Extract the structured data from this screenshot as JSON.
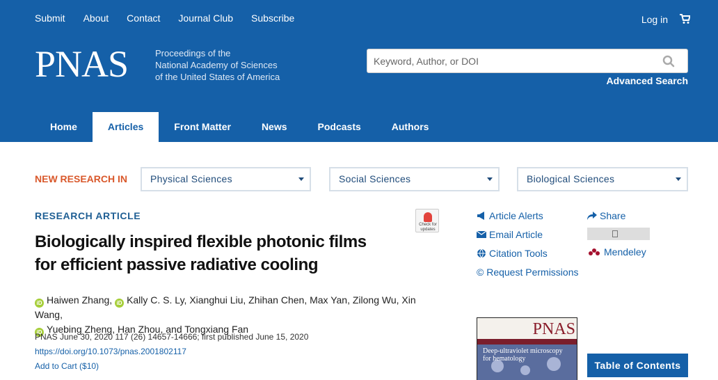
{
  "top_nav": [
    "Submit",
    "About",
    "Contact",
    "Journal Club",
    "Subscribe"
  ],
  "login": "Log in",
  "logo": "PNAS",
  "tagline": [
    "Proceedings of the",
    "National Academy of Sciences",
    "of the United States of America"
  ],
  "search": {
    "placeholder": "Keyword, Author, or DOI"
  },
  "advanced_search": "Advanced Search",
  "main_nav": [
    "Home",
    "Articles",
    "Front Matter",
    "News",
    "Podcasts",
    "Authors"
  ],
  "active_tab": "Articles",
  "new_research": {
    "label": "NEW RESEARCH IN",
    "dropdowns": [
      "Physical Sciences",
      "Social Sciences",
      "Biological Sciences"
    ]
  },
  "article": {
    "type": "RESEARCH ARTICLE",
    "check_updates": "Check for updates",
    "title_line1": "Biologically inspired flexible photonic films",
    "title_line2": "for efficient passive radiative cooling",
    "authors": [
      {
        "name": "Haiwen Zhang",
        "orcid": true
      },
      {
        "name": "Kally C. S. Ly",
        "orcid": true
      },
      {
        "name": "Xianghui Liu",
        "orcid": false
      },
      {
        "name": "Zhihan Chen",
        "orcid": false
      },
      {
        "name": "Max Yan",
        "orcid": false
      },
      {
        "name": "Zilong Wu",
        "orcid": false
      },
      {
        "name": "Xin Wang",
        "orcid": false
      },
      {
        "name": "Yuebing Zheng",
        "orcid": true
      },
      {
        "name": "Han Zhou",
        "orcid": false
      },
      {
        "name": "Tongxiang Fan",
        "orcid": false
      }
    ],
    "citation": "PNAS June 30, 2020 117 (26) 14657-14666; first published June 15, 2020",
    "doi": "https://doi.org/10.1073/pnas.2001802117",
    "add_to_cart": "Add to Cart ($10)"
  },
  "tools": {
    "article_alerts": "Article Alerts",
    "email_article": "Email Article",
    "citation_tools": "Citation Tools",
    "request_permissions": "© Request Permissions",
    "share": "Share",
    "mendeley": "Mendeley"
  },
  "cover": {
    "logo": "PNAS",
    "headline": "Deep-ultraviolet microscopy for hematology"
  },
  "toc_button": "Table of Contents",
  "colors": {
    "header": "#1560a8",
    "accent_orange": "#d9582b",
    "orcid_green": "#a6ce39"
  }
}
